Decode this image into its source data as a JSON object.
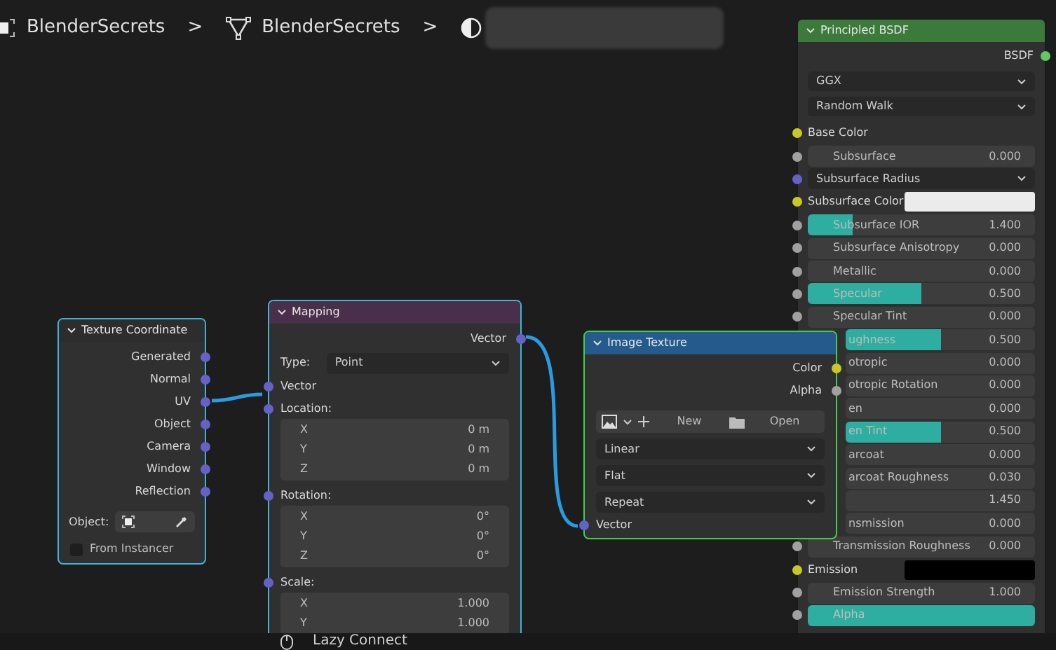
{
  "breadcrumb": {
    "items": [
      {
        "kind": "object",
        "label": "BlenderSecrets"
      },
      {
        "kind": "separator",
        "label": ">"
      },
      {
        "kind": "mesh",
        "label": "BlenderSecrets"
      },
      {
        "kind": "separator",
        "label": ">"
      },
      {
        "kind": "material"
      }
    ]
  },
  "texture_coordinate": {
    "title": "Texture Coordinate",
    "selected": true,
    "outputs": [
      {
        "label": "Generated",
        "socket": {
          "color": "#6363c7"
        }
      },
      {
        "label": "Normal",
        "socket": {
          "color": "#6363c7"
        }
      },
      {
        "label": "UV",
        "socket": {
          "color": "#6363c7"
        }
      },
      {
        "label": "Object",
        "socket": {
          "color": "#6363c7"
        }
      },
      {
        "label": "Camera",
        "socket": {
          "color": "#6363c7"
        }
      },
      {
        "label": "Window",
        "socket": {
          "color": "#6363c7"
        }
      },
      {
        "label": "Reflection",
        "socket": {
          "color": "#6363c7"
        }
      }
    ],
    "object_label": "Object:",
    "from_instancer": {
      "label": "From Instancer",
      "checked": false
    }
  },
  "mapping": {
    "title": "Mapping",
    "selected": true,
    "output": {
      "label": "Vector",
      "socket": {
        "color": "#6363c7"
      }
    },
    "type": {
      "label": "Type:",
      "value": "Point"
    },
    "input": {
      "label": "Vector",
      "socket": {
        "color": "#6363c7"
      }
    },
    "groups": [
      {
        "label": "Location:",
        "socket": {
          "color": "#6363c7"
        },
        "fields": [
          {
            "axis": "X",
            "value": "0 m"
          },
          {
            "axis": "Y",
            "value": "0 m"
          },
          {
            "axis": "Z",
            "value": "0 m"
          }
        ]
      },
      {
        "label": "Rotation:",
        "socket": {
          "color": "#6363c7"
        },
        "fields": [
          {
            "axis": "X",
            "value": "0°"
          },
          {
            "axis": "Y",
            "value": "0°"
          },
          {
            "axis": "Z",
            "value": "0°"
          }
        ]
      },
      {
        "label": "Scale:",
        "socket": {
          "color": "#6363c7"
        },
        "fields": [
          {
            "axis": "X",
            "value": "1.000"
          },
          {
            "axis": "Y",
            "value": "1.000"
          }
        ]
      }
    ]
  },
  "image_texture": {
    "title": "Image Texture",
    "active": true,
    "outputs": [
      {
        "label": "Color",
        "socket": {
          "color": "#c7c729"
        }
      },
      {
        "label": "Alpha",
        "socket": {
          "color": "#a1a1a1"
        }
      }
    ],
    "new_button": "New",
    "open_button": "Open",
    "dropdowns": [
      "Linear",
      "Flat",
      "Repeat"
    ],
    "input": {
      "label": "Vector",
      "socket": {
        "color": "#6363c7"
      }
    }
  },
  "principled_bsdf": {
    "title": "Principled BSDF",
    "selected": false,
    "output": {
      "label": "BSDF",
      "socket": {
        "color": "#63c763"
      }
    },
    "dropdowns": [
      "GGX",
      "Random Walk"
    ],
    "rows": [
      {
        "kind": "label",
        "label": "Base Color",
        "socket": {
          "color": "#c7c729"
        }
      },
      {
        "kind": "slider",
        "label": "Subsurface",
        "value": "0.000",
        "socket": {
          "color": "#a1a1a1"
        }
      },
      {
        "kind": "dropdown",
        "label": "Subsurface Radius",
        "socket": {
          "color": "#6363c7"
        }
      },
      {
        "kind": "color",
        "label": "Subsurface Color",
        "color": "#ebebeb",
        "socket": {
          "color": "#c7c729"
        }
      },
      {
        "kind": "slider",
        "label": "Subsurface IOR",
        "value": "1.400",
        "level": 0.2,
        "socket": {
          "color": "#a1a1a1"
        }
      },
      {
        "kind": "slider",
        "label": "Subsurface Anisotropy",
        "value": "0.000",
        "socket": {
          "color": "#a1a1a1"
        }
      },
      {
        "kind": "slider",
        "label": "Metallic",
        "value": "0.000",
        "socket": {
          "color": "#a1a1a1"
        }
      },
      {
        "kind": "slider",
        "label": "Specular",
        "value": "0.500",
        "level": 0.5,
        "socket": {
          "color": "#a1a1a1"
        }
      },
      {
        "kind": "slider",
        "label": "Specular Tint",
        "value": "0.000",
        "socket": {
          "color": "#a1a1a1"
        }
      },
      {
        "kind": "slider",
        "label": "ughness",
        "value": "0.500",
        "level": 0.5
      },
      {
        "kind": "slider",
        "label": "otropic",
        "value": "0.000"
      },
      {
        "kind": "slider",
        "label": "otropic Rotation",
        "value": "0.000"
      },
      {
        "kind": "slider",
        "label": "en",
        "value": "0.000"
      },
      {
        "kind": "slider",
        "label": "en Tint",
        "value": "0.500",
        "level": 0.5
      },
      {
        "kind": "slider",
        "label": "arcoat",
        "value": "0.000"
      },
      {
        "kind": "slider",
        "label": "arcoat Roughness",
        "value": "0.030"
      },
      {
        "kind": "slider",
        "value": "1.450"
      },
      {
        "kind": "slider",
        "label": "nsmission",
        "value": "0.000"
      },
      {
        "kind": "slider",
        "label": "Transmission Roughness",
        "value": "0.000",
        "socket": {
          "color": "#a1a1a1"
        }
      },
      {
        "kind": "color",
        "label": "Emission",
        "color": "#000000",
        "socket": {
          "color": "#c7c729"
        }
      },
      {
        "kind": "slider",
        "label": "Emission Strength",
        "value": "1.000",
        "socket": {
          "color": "#a1a1a1"
        }
      },
      {
        "kind": "slider",
        "label": "Alpha",
        "level": 1,
        "socket": {
          "color": "#a1a1a1"
        }
      }
    ]
  },
  "status_bar": {
    "label": "Lazy Connect"
  }
}
